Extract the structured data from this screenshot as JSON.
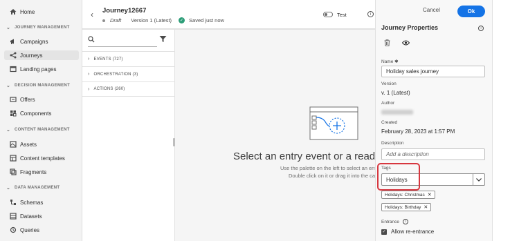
{
  "nav": {
    "home": "Home",
    "sections": [
      {
        "heading": "JOURNEY MANAGEMENT",
        "items": [
          "Campaigns",
          "Journeys",
          "Landing pages"
        ]
      },
      {
        "heading": "DECISION MANAGEMENT",
        "items": [
          "Offers",
          "Components"
        ]
      },
      {
        "heading": "CONTENT MANAGEMENT",
        "items": [
          "Assets",
          "Content templates",
          "Fragments"
        ]
      },
      {
        "heading": "DATA MANAGEMENT",
        "items": [
          "Schemas",
          "Datasets",
          "Queries"
        ]
      }
    ],
    "active_item": "Journeys"
  },
  "journey": {
    "title": "Journey12667",
    "status": "Draft",
    "version": "Version 1 (Latest)",
    "saved": "Saved just now",
    "test_label": "Test"
  },
  "palette": {
    "categories": [
      "EVENTS (727)",
      "ORCHESTRATION (3)",
      "ACTIONS (260)"
    ]
  },
  "canvas": {
    "title": "Select an entry event or a read se",
    "hint_line1": "Use the palette on the left to select an entry",
    "hint_line2": "Double click on it or drag it into the canv"
  },
  "props": {
    "cancel_label": "Cancel",
    "ok_label": "Ok",
    "title": "Journey Properties",
    "name_label": "Name ✱",
    "name_value": "Holiday sales journey",
    "version_label": "Version",
    "version_value": "v. 1 (Latest)",
    "author_label": "Author",
    "created_label": "Created",
    "created_value": "February 28, 2023 at 1:57 PM",
    "description_label": "Description",
    "description_placeholder": "Add a description",
    "tags_label": "Tags",
    "tags_input_value": "Holidays",
    "tags": [
      "Holidays: Christmas",
      "Holidays: Birthday"
    ],
    "entrance_label": "Entrance",
    "reentrance_label": "Allow re-entrance"
  },
  "colors": {
    "accent": "#1473e6",
    "highlight": "#d7373f",
    "saved_green": "#2d9d78"
  }
}
